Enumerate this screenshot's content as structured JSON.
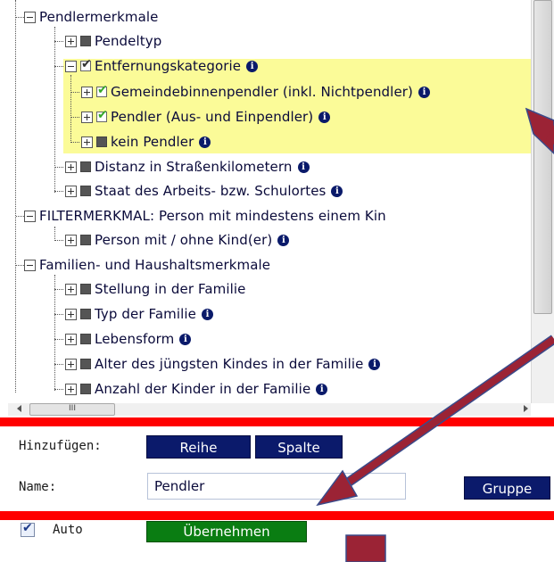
{
  "tree": {
    "nodes": [
      {
        "label": "Pendlermerkmale",
        "info": false
      },
      {
        "label": "Pendeltyp",
        "info": false
      },
      {
        "label": "Entfernungskategorie",
        "info": true
      },
      {
        "label": "Gemeindebinnenpendler (inkl. Nichtpendler)",
        "info": true
      },
      {
        "label": "Pendler (Aus- und Einpendler)",
        "info": true
      },
      {
        "label": "kein Pendler",
        "info": true
      },
      {
        "label": "Distanz in Straßenkilometern",
        "info": true
      },
      {
        "label": "Staat des Arbeits- bzw. Schulortes",
        "info": true
      },
      {
        "label": "FILTERMERKMAL: Person mit mindestens einem Kin",
        "info": false
      },
      {
        "label": "Person mit / ohne Kind(er)",
        "info": true
      },
      {
        "label": "Familien- und Haushaltsmerkmale",
        "info": false
      },
      {
        "label": "Stellung in der Familie",
        "info": false
      },
      {
        "label": "Typ der Familie",
        "info": true
      },
      {
        "label": "Lebensform",
        "info": true
      },
      {
        "label": "Alter des jüngsten Kindes in der Familie",
        "info": true
      },
      {
        "label": "Anzahl der Kinder in der Familie",
        "info": true
      }
    ],
    "info_glyph": "i"
  },
  "scrollbar": {
    "h_thumb_glyph": "III"
  },
  "panel": {
    "add_label": "Hinzufügen:",
    "row_button": "Reihe",
    "column_button": "Spalte",
    "name_label": "Name:",
    "name_value": "Pendler",
    "group_button": "Gruppe",
    "auto_label": "Auto",
    "apply_button": "Übernehmen"
  },
  "colors": {
    "highlight": "#fbfb98",
    "navy_button": "#0b1a6b",
    "apply_button": "#0a7d12",
    "annotation_arrow": "#9b2335",
    "annotation_bar": "#ff0000"
  },
  "icons": [
    "expand-minus-icon",
    "expand-plus-icon",
    "checkbox-icon",
    "info-icon",
    "annotation-arrow-icon"
  ]
}
